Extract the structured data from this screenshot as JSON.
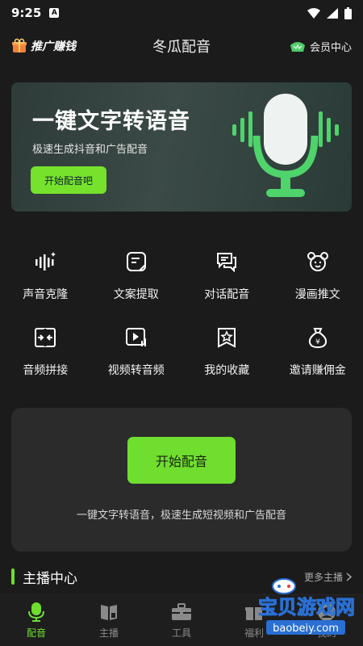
{
  "status_bar": {
    "time": "9:25",
    "notification_badge": "A"
  },
  "header": {
    "promo_label": "推广赚钱",
    "title": "冬瓜配音",
    "vip_label": "会员中心"
  },
  "banner": {
    "title": "一键文字转语音",
    "subtitle": "极速生成抖音和广告配音",
    "button_label": "开始配音吧"
  },
  "features": [
    {
      "label": "声音克隆",
      "icon": "voice-wave-icon"
    },
    {
      "label": "文案提取",
      "icon": "note-icon"
    },
    {
      "label": "对话配音",
      "icon": "chat-icon"
    },
    {
      "label": "漫画推文",
      "icon": "bear-icon"
    },
    {
      "label": "音频拼接",
      "icon": "merge-icon"
    },
    {
      "label": "视频转音频",
      "icon": "video-audio-icon"
    },
    {
      "label": "我的收藏",
      "icon": "star-bookmark-icon"
    },
    {
      "label": "邀请赚佣金",
      "icon": "money-bag-icon"
    }
  ],
  "card": {
    "button_label": "开始配音",
    "description": "一键文字转语音，极速生成短视频和广告配音"
  },
  "section": {
    "title": "主播中心",
    "more_label": "更多主播"
  },
  "tabbar": [
    {
      "label": "配音",
      "icon": "mic-icon",
      "active": true
    },
    {
      "label": "主播",
      "icon": "book-icon",
      "active": false
    },
    {
      "label": "工具",
      "icon": "toolbox-icon",
      "active": false
    },
    {
      "label": "福利",
      "icon": "gift-icon",
      "active": false
    },
    {
      "label": "我的",
      "icon": "user-icon",
      "active": false
    }
  ],
  "watermark": {
    "text": "宝贝游戏网",
    "url_text": "baobeiy.com"
  },
  "colors": {
    "accent": "#6fde2f",
    "background": "#1b1b1b",
    "card": "#2b2b2b"
  }
}
